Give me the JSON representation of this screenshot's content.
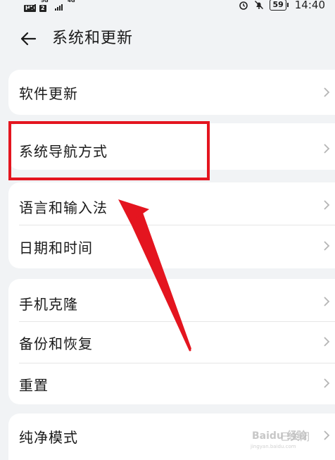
{
  "status_bar": {
    "network_tags": [
      "HD",
      "2",
      "5G",
      "4G"
    ],
    "battery": "59",
    "time": "14:40",
    "icons": [
      "alarm-icon",
      "mute-icon"
    ]
  },
  "header": {
    "back_icon": "arrow-left-icon",
    "title": "系统和更新"
  },
  "groups": [
    {
      "items": [
        {
          "label": "软件更新"
        }
      ]
    },
    {
      "items": [
        {
          "label": "系统导航方式"
        }
      ]
    },
    {
      "items": [
        {
          "label": "语言和输入法"
        },
        {
          "label": "日期和时间"
        }
      ]
    },
    {
      "items": [
        {
          "label": "手机克隆"
        },
        {
          "label": "备份和恢复"
        },
        {
          "label": "重置"
        }
      ]
    },
    {
      "items": [
        {
          "label": "纯净模式"
        }
      ]
    }
  ],
  "annotation": {
    "color": "#e4151f"
  },
  "watermark": {
    "main": "Baidu 经验",
    "sub": "jingyan.baidu.com",
    "overlay": "已关闭"
  }
}
